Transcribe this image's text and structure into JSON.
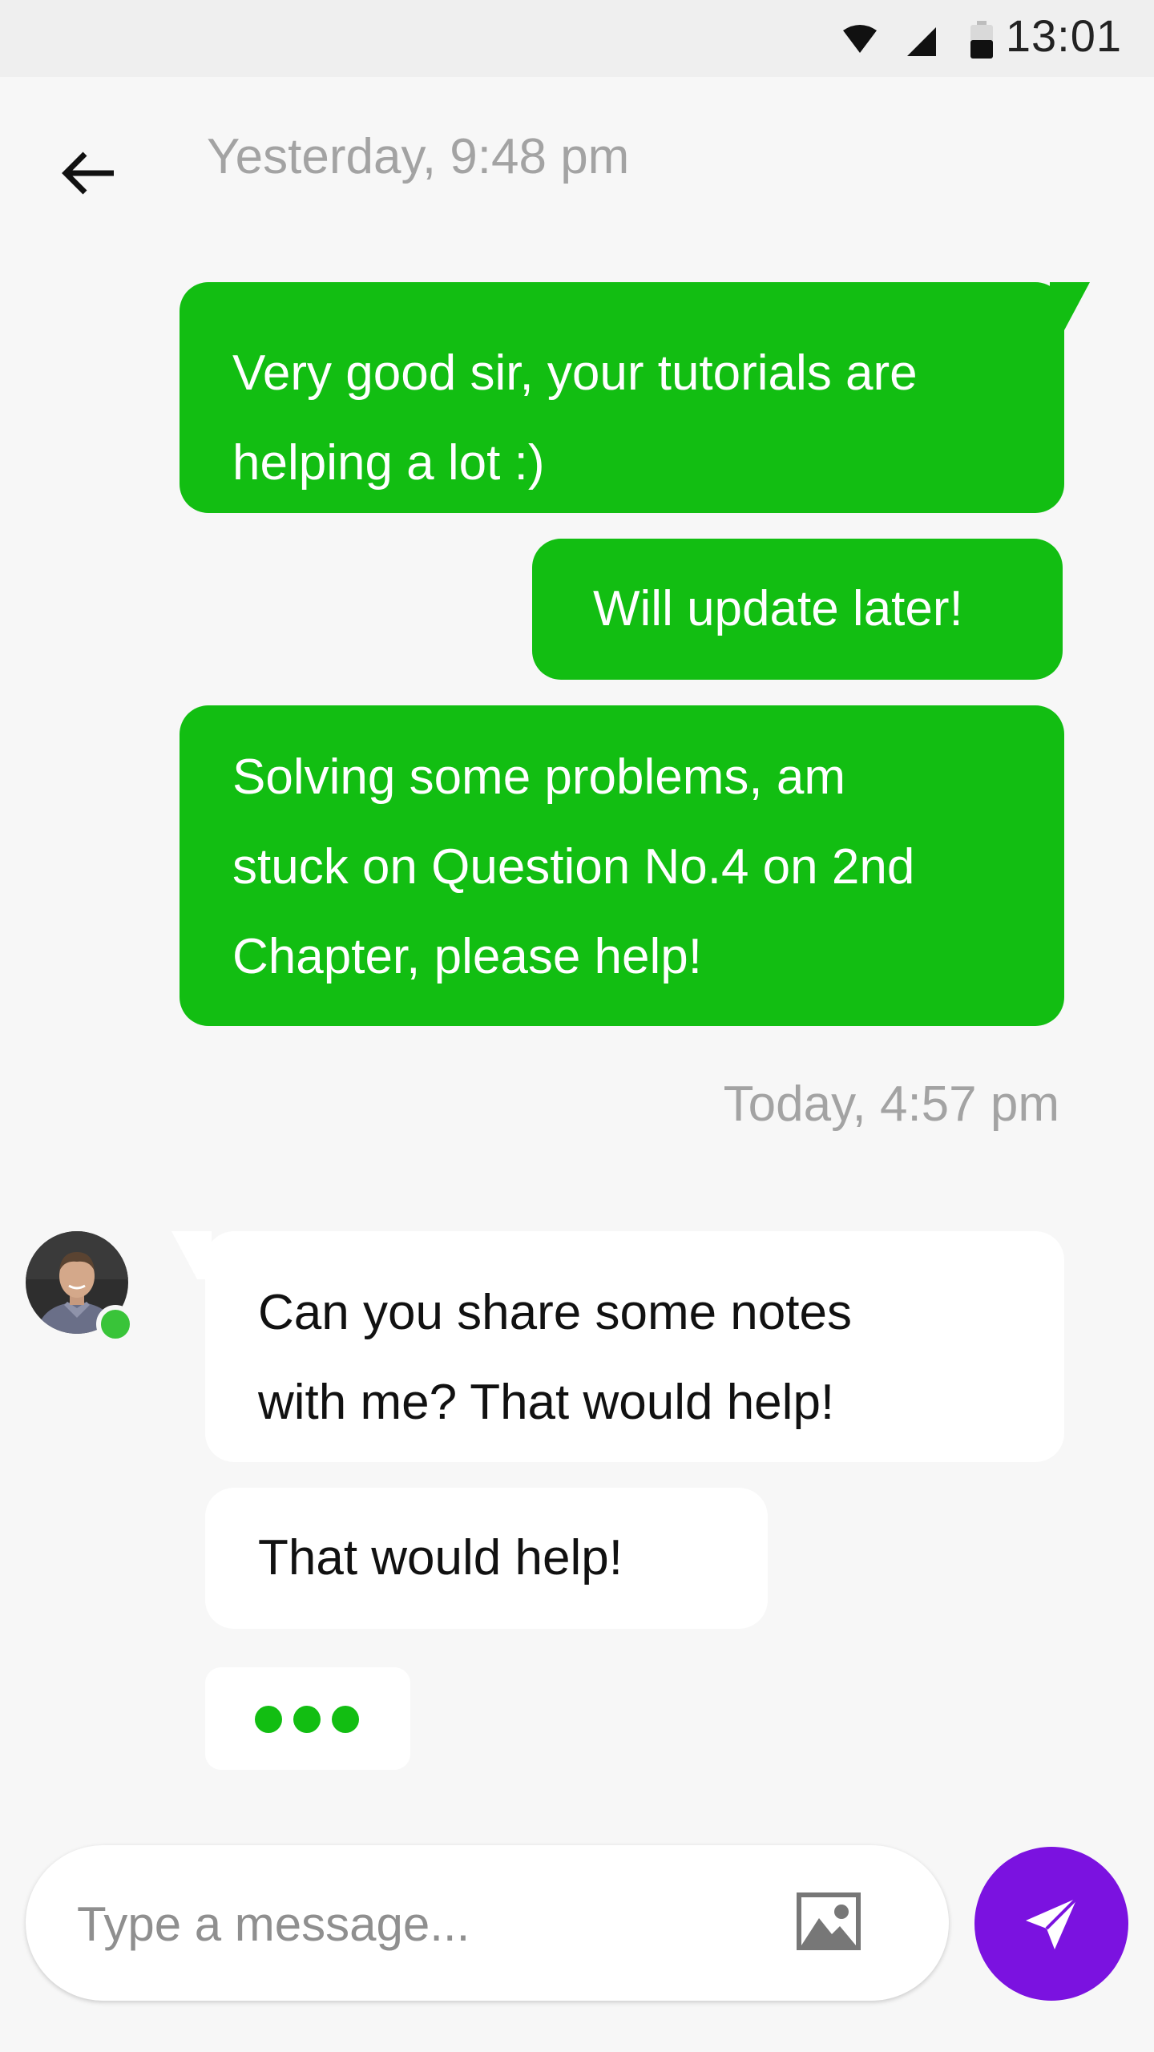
{
  "status_bar": {
    "time": "13:01",
    "icons": [
      "wifi-icon",
      "signal-icon",
      "battery-icon"
    ]
  },
  "header": {
    "date": "Yesterday, 9:48 pm",
    "back_icon": "arrow-left-icon"
  },
  "messages_sent": [
    {
      "text": "Very good sir, your tutorials are\nhelping a lot :)"
    },
    {
      "text": "Will update later!"
    },
    {
      "text": "Solving some problems, am\nstuck on Question No.4 on 2nd\nChapter, please help!"
    }
  ],
  "today_date": "Today, 4:57 pm",
  "contact": {
    "avatar": "avatar-photo",
    "online": true
  },
  "messages_received": [
    {
      "text": "Can you share some notes\nwith me? That would help!"
    },
    {
      "text": "That would help!"
    }
  ],
  "typing_indicator": {
    "dots": 3
  },
  "composer": {
    "placeholder": "Type a message...",
    "image_icon": "image-icon",
    "send_icon": "send-icon"
  },
  "colors": {
    "sent_bubble": "#12be12",
    "received_bubble": "#ffffff",
    "send_button": "#7b12e0",
    "online_dot": "#39c439",
    "muted_text": "#a3a3a3"
  }
}
